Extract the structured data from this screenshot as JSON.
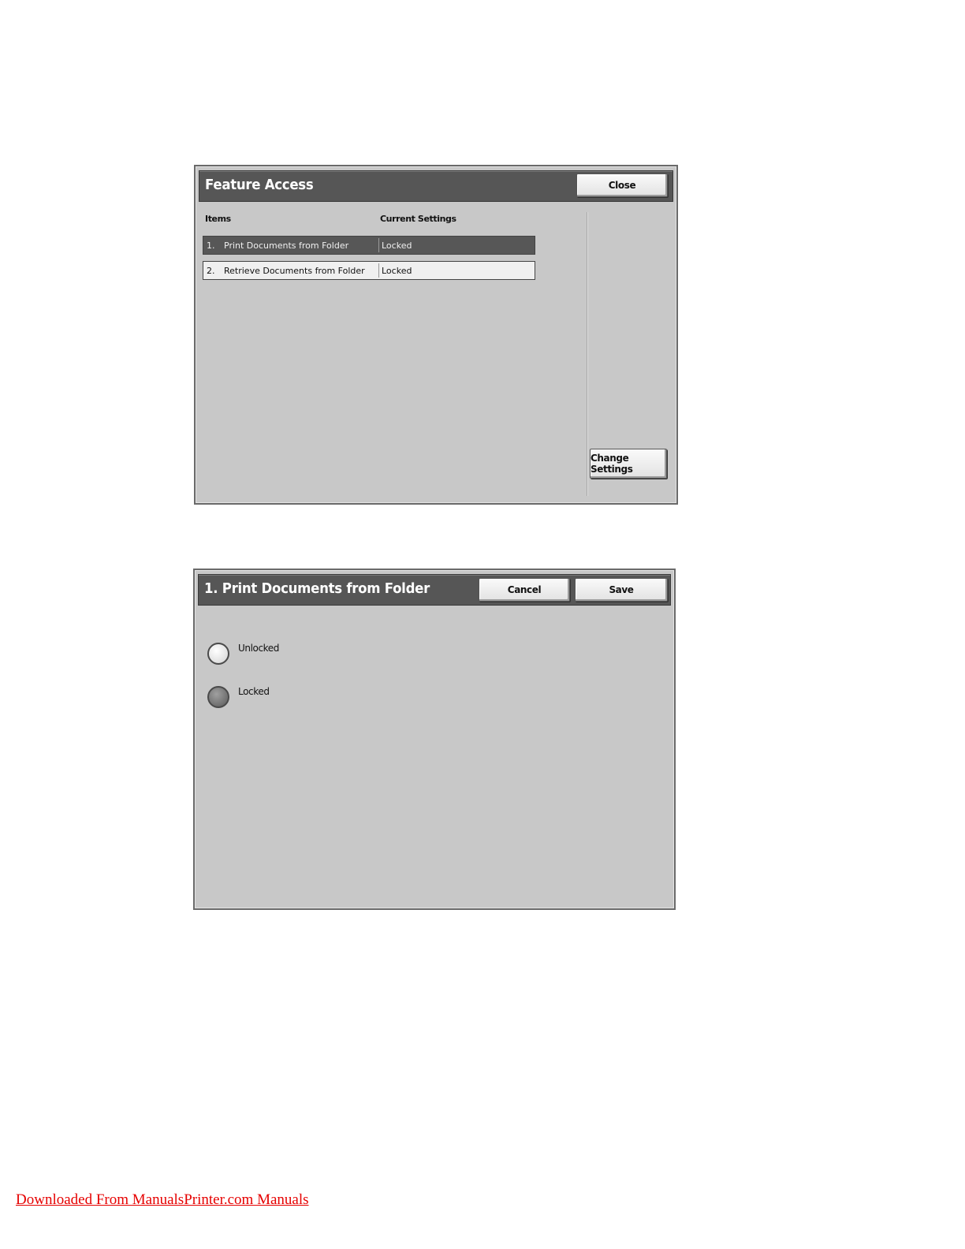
{
  "feature_access": {
    "title": "Feature Access",
    "close_label": "Close",
    "columns": {
      "items": "Items",
      "current_settings": "Current Settings"
    },
    "rows": [
      {
        "num": "1.",
        "name": "Print Documents from Folder",
        "value": "Locked",
        "selected": true
      },
      {
        "num": "2.",
        "name": "Retrieve Documents from Folder",
        "value": "Locked",
        "selected": false
      }
    ],
    "change_settings_label": "Change Settings"
  },
  "print_documents": {
    "title": "1. Print Documents from Folder",
    "cancel_label": "Cancel",
    "save_label": "Save",
    "options": [
      {
        "label": "Unlocked",
        "selected": false
      },
      {
        "label": "Locked",
        "selected": true
      }
    ]
  },
  "footer": {
    "link_text": "Downloaded From ManualsPrinter.com Manuals"
  },
  "colors": {
    "footer_link": "#e60000",
    "titlebar": "#565656",
    "panel": "#c8c8c8"
  }
}
